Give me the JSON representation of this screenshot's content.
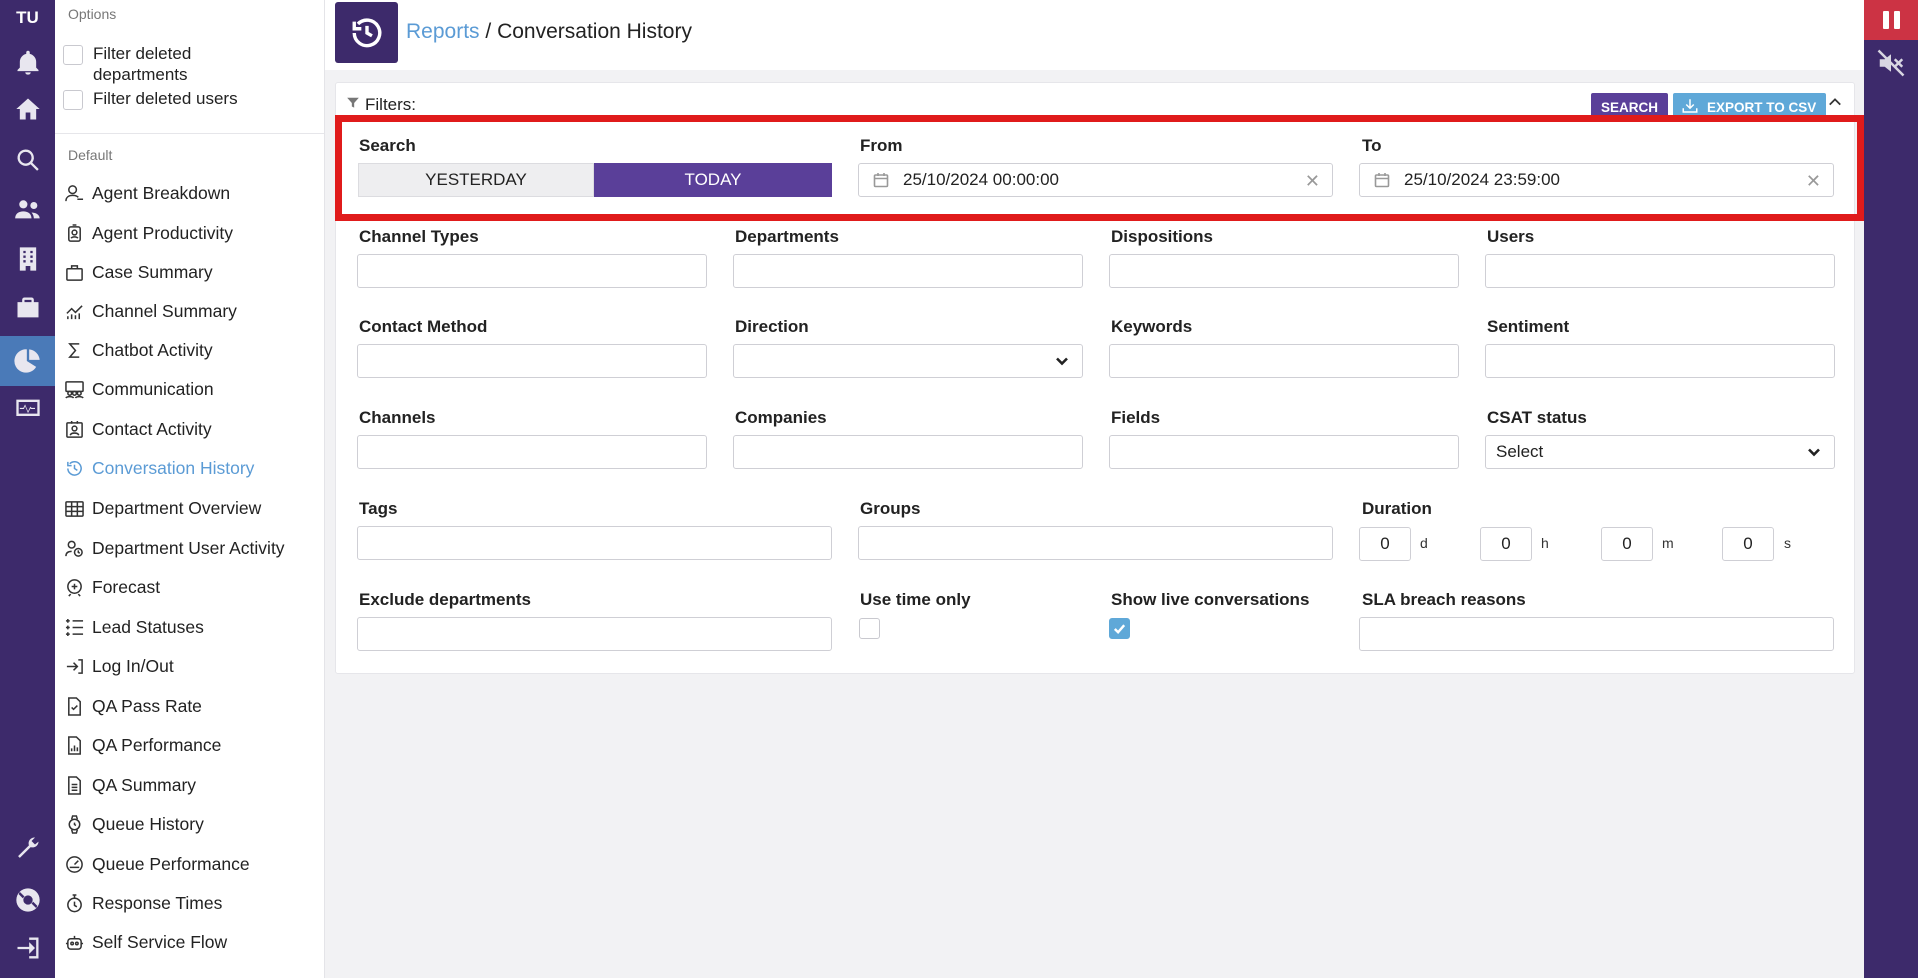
{
  "rail": {
    "initials": "TU",
    "icons": [
      "bell-icon",
      "home-icon",
      "search-icon",
      "users-icon",
      "building-icon",
      "briefcase-icon",
      "reports-icon",
      "monitor-icon",
      "wrench-icon",
      "lifebuoy-icon",
      "logout-icon"
    ]
  },
  "sidebar": {
    "options_title": "Options",
    "options": [
      {
        "label": "Filter deleted departments",
        "checked": false
      },
      {
        "label": "Filter deleted users",
        "checked": false
      }
    ],
    "default_title": "Default",
    "reports": [
      {
        "label": "Agent Breakdown",
        "icon": "agent-icon"
      },
      {
        "label": "Agent Productivity",
        "icon": "badge-icon"
      },
      {
        "label": "Case Summary",
        "icon": "case-icon"
      },
      {
        "label": "Channel Summary",
        "icon": "chart-line-icon"
      },
      {
        "label": "Chatbot Activity",
        "icon": "sigma-icon"
      },
      {
        "label": "Communication",
        "icon": "group-icon"
      },
      {
        "label": "Contact Activity",
        "icon": "contact-card-icon"
      },
      {
        "label": "Conversation History",
        "icon": "history-icon",
        "active": true
      },
      {
        "label": "Department Overview",
        "icon": "building-grid-icon"
      },
      {
        "label": "Department User Activity",
        "icon": "user-clock-icon"
      },
      {
        "label": "Forecast",
        "icon": "forecast-icon"
      },
      {
        "label": "Lead Statuses",
        "icon": "list-status-icon"
      },
      {
        "label": "Log In/Out",
        "icon": "login-icon"
      },
      {
        "label": "QA Pass Rate",
        "icon": "doc-check-icon"
      },
      {
        "label": "QA Performance",
        "icon": "doc-chart-icon"
      },
      {
        "label": "QA Summary",
        "icon": "doc-list-icon"
      },
      {
        "label": "Queue History",
        "icon": "watch-icon"
      },
      {
        "label": "Queue Performance",
        "icon": "gauge-icon"
      },
      {
        "label": "Response Times",
        "icon": "stopwatch-icon"
      },
      {
        "label": "Self Service Flow",
        "icon": "robot-icon"
      }
    ]
  },
  "header": {
    "breadcrumb_link": "Reports",
    "breadcrumb_sep": "/",
    "breadcrumb_current": "Conversation History"
  },
  "filters": {
    "title": "Filters:",
    "search_button": "SEARCH",
    "export_button": "EXPORT TO CSV",
    "search_label": "Search",
    "yesterday": "YESTERDAY",
    "today": "TODAY",
    "from_label": "From",
    "from_value": "25/10/2024 00:00:00",
    "to_label": "To",
    "to_value": "25/10/2024 23:59:00",
    "clear_glyph": "✕",
    "channel_types": "Channel Types",
    "departments": "Departments",
    "dispositions": "Dispositions",
    "users": "Users",
    "contact_method": "Contact Method",
    "direction": "Direction",
    "keywords": "Keywords",
    "sentiment": "Sentiment",
    "channels": "Channels",
    "companies": "Companies",
    "fields": "Fields",
    "csat_status": "CSAT status",
    "csat_value": "Select",
    "tags": "Tags",
    "groups": "Groups",
    "duration": "Duration",
    "dur_d": "0",
    "dur_d_unit": "d",
    "dur_h": "0",
    "dur_h_unit": "h",
    "dur_m": "0",
    "dur_m_unit": "m",
    "dur_s": "0",
    "dur_s_unit": "s",
    "exclude_departments": "Exclude departments",
    "use_time_only": "Use time only",
    "use_time_only_checked": false,
    "show_live": "Show live conversations",
    "show_live_checked": true,
    "sla_breach": "SLA breach reasons"
  },
  "colors": {
    "brand": "#3d2a6b",
    "accent": "#5a3f99",
    "link": "#5b9bd5",
    "highlight": "#e01b1b",
    "alert": "#cc3344"
  }
}
